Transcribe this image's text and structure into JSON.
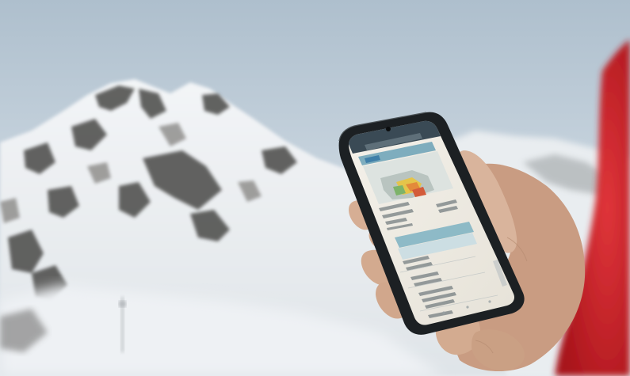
{
  "scene": {
    "description_icon": "mountain-photo",
    "sky_top": "#b9c9d6",
    "sky_bottom": "#dce4ea",
    "snow": "#eef1f3",
    "rock": "#4b4a48",
    "jacket": "#d2242b",
    "phone_body": "#1f2326",
    "skin": "#d9b49c"
  },
  "phone": {
    "url": "",
    "badge": "",
    "lines": []
  }
}
